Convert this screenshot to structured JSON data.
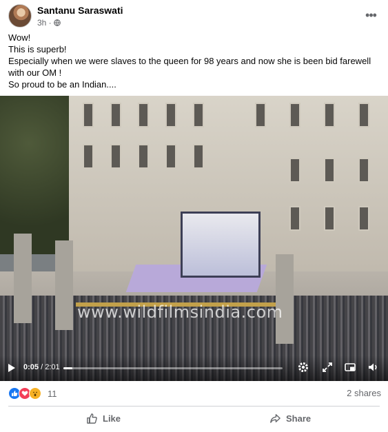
{
  "post": {
    "author": "Santanu Saraswati",
    "time": "3h ·",
    "audience_icon": "globe-icon",
    "more_icon": "more-options-icon",
    "lines": [
      "Wow!",
      "This is superb!",
      "Especially when we were slaves to the queen for 98 years and now she is been bid farewell with our OM !",
      "So proud to be an Indian...."
    ]
  },
  "video": {
    "watermark": "www.wildfilmsindia.com",
    "current_time": "0:05",
    "total_time": "/ 2:01",
    "progress": 0.041,
    "controls": [
      "play-icon",
      "settings-icon",
      "fullscreen-icon",
      "picture-in-picture-icon",
      "volume-icon"
    ]
  },
  "engagement": {
    "reactions": [
      "like",
      "love",
      "wow"
    ],
    "reaction_count": "11",
    "shares": "2 shares"
  },
  "actions": {
    "like_label": "Like",
    "share_label": "Share"
  },
  "colors": {
    "accent": "#1877f2",
    "secondary_text": "#65676b",
    "love": "#f33e58",
    "wow": "#f7b125"
  }
}
